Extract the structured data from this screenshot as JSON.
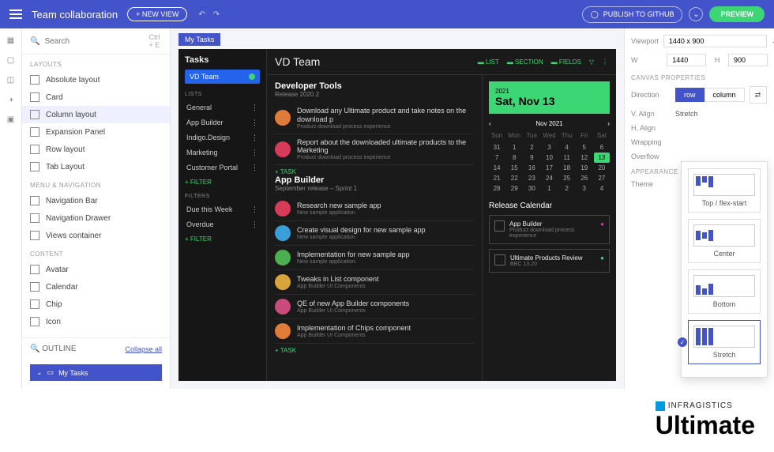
{
  "header": {
    "title": "Team collaboration",
    "new_view": "+ NEW VIEW",
    "publish": "PUBLISH TO GITHUB",
    "preview": "PREVIEW"
  },
  "search": {
    "placeholder": "Search",
    "shortcut": "Ctrl + E"
  },
  "sections": {
    "layouts": {
      "label": "LAYOUTS",
      "items": [
        "Absolute layout",
        "Card",
        "Column layout",
        "Expansion Panel",
        "Row layout",
        "Tab Layout"
      ]
    },
    "menu": {
      "label": "MENU & NAVIGATION",
      "items": [
        "Navigation Bar",
        "Navigation Drawer",
        "Views container"
      ]
    },
    "content": {
      "label": "CONTENT",
      "items": [
        "Avatar",
        "Calendar",
        "Chip",
        "Icon"
      ]
    }
  },
  "outline": {
    "label": "OUTLINE",
    "collapse": "Collapse all",
    "tree_item": "My Tasks"
  },
  "canvas_tab": "My Tasks",
  "app": {
    "side_title": "Tasks",
    "team": "VD Team",
    "lists_label": "LISTS",
    "lists": [
      "General",
      "App Builder",
      "Indigo.Design",
      "Marketing",
      "Customer Portal"
    ],
    "filter_action": "+  FILTER",
    "filters_label": "FILTERS",
    "filters": [
      "Due this Week",
      "Overdue"
    ],
    "header_title": "VD Team",
    "views": [
      "LIST",
      "SECTION",
      "FIELDS"
    ],
    "groups": [
      {
        "title": "Developer Tools",
        "sub": "Release 2020.2",
        "tasks": [
          {
            "text": "Download any Ultimate product and take notes on the download p",
            "sub": "Product download process experience",
            "color": "#e07b3a"
          },
          {
            "text": "Report about the downloaded ultimate products to the Marketing",
            "sub": "Product download process experience",
            "color": "#d83a5a"
          }
        ],
        "add": "+  TASK"
      },
      {
        "title": "App Builder",
        "sub": "September release – Sprint 1",
        "tasks": [
          {
            "text": "Research new sample app",
            "sub": "New sample application",
            "color": "#d83a5a"
          },
          {
            "text": "Create visual design for new sample app",
            "sub": "New sample application",
            "color": "#3a9ed8"
          },
          {
            "text": "Implementation for new sample app",
            "sub": "New sample application",
            "color": "#4caf50"
          },
          {
            "text": "Tweaks in List component",
            "sub": "App Builder UI Components",
            "color": "#d8a53a"
          },
          {
            "text": "QE of new App Builder components",
            "sub": "App Builder UI Components",
            "color": "#c94b7b"
          },
          {
            "text": "Implementation of Chips component",
            "sub": "App Builder UI Components",
            "color": "#e07b3a"
          }
        ],
        "add": "+  TASK"
      }
    ],
    "date": {
      "year": "2021",
      "full": "Sat, Nov 13",
      "month": "Nov 2021",
      "days": [
        "Sun",
        "Mon",
        "Tue",
        "Wed",
        "Thu",
        "Fri",
        "Sat"
      ],
      "weeks": [
        [
          "31",
          "1",
          "2",
          "3",
          "4",
          "5",
          "6"
        ],
        [
          "7",
          "8",
          "9",
          "10",
          "11",
          "12",
          "13"
        ],
        [
          "14",
          "15",
          "16",
          "17",
          "18",
          "19",
          "20"
        ],
        [
          "21",
          "22",
          "23",
          "24",
          "25",
          "26",
          "27"
        ],
        [
          "28",
          "29",
          "30",
          "1",
          "2",
          "3",
          "4"
        ]
      ],
      "highlight": "13"
    },
    "release": {
      "title": "Release Calendar",
      "items": [
        {
          "name": "App Builder",
          "sub": "Product download process experience"
        },
        {
          "name": "Ultimate Products Review",
          "sub": "BBC 13.20"
        }
      ]
    }
  },
  "rp": {
    "viewport_label": "Viewport",
    "viewport": "1440 x 900",
    "w_label": "W",
    "w": "1440",
    "h_label": "H",
    "h": "900",
    "canvas_props": "CANVAS PROPERTIES",
    "direction": "Direction",
    "row": "row",
    "column": "column",
    "valign": "V. Align",
    "valign_val": "Stretch",
    "halign": "H. Align",
    "wrapping": "Wrapping",
    "overflow": "Overflow",
    "appearance": "APPEARANCE",
    "theme": "Theme",
    "align_opts": [
      "Top / flex-start",
      "Center",
      "Bottom",
      "Stretch"
    ]
  },
  "brand": {
    "name": "INFRAGISTICS",
    "product": "Ultimate"
  }
}
